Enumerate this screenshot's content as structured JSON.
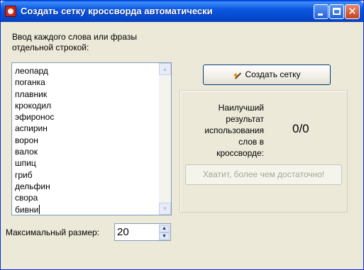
{
  "window": {
    "title": "Создать сетку кроссворда автоматически"
  },
  "input": {
    "label": "Ввод каждого слова или фразы\nотдельной строкой:",
    "words": [
      "леопард",
      "поганка",
      "плавник",
      "крокодил",
      "эфиронос",
      "аспирин",
      "ворон",
      "валок",
      "шпиц",
      "гриб",
      "дельфин",
      "свора",
      "бивни"
    ]
  },
  "max_size": {
    "label": "Максимальный размер:",
    "value": "20"
  },
  "buttons": {
    "create_label": "Создать сетку",
    "enough_label": "Хватит, более чем достаточно!"
  },
  "result": {
    "label": "Наилучший\nрезультат\nиспользования\nслов в\nкроссворде:",
    "value": "0/0"
  },
  "icons": {
    "app": "crossword-app-icon",
    "create": "magic-wand-icon"
  },
  "colors": {
    "titlebar": "#0a5fe8",
    "window_bg": "#ece9d8",
    "disabled_text": "#a7a697"
  }
}
